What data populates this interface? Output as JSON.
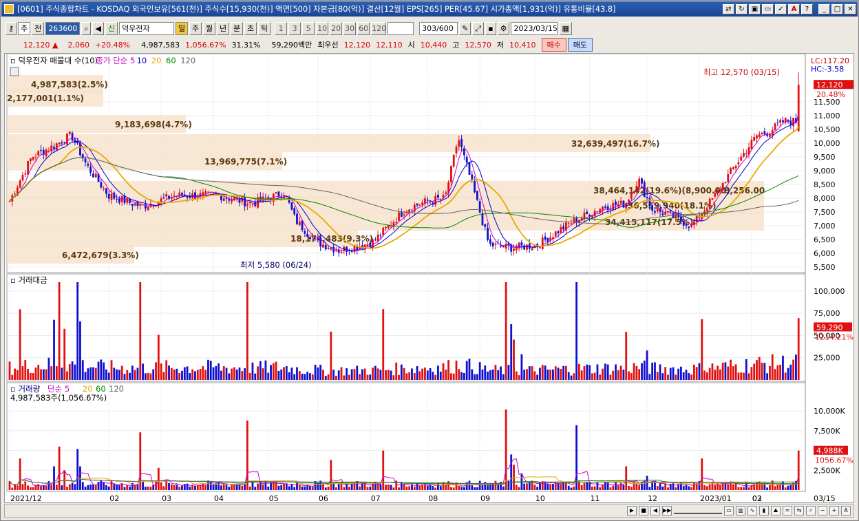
{
  "window": {
    "title": "[0601] 주식종합차트 - KOSDAQ 외국인보유[561(천)] 주식수[15,930(천)] 액면[500] 자본금[80(억)] 결산[12월] EPS[265] PER[45.67] 시가총액[1,931(억)] 유통비율[43.8]"
  },
  "toolbar": {
    "unit": "주",
    "pre": "전",
    "code": "263600",
    "badge": "신",
    "name": "덕우전자",
    "mode": "일",
    "periods": [
      "주",
      "월",
      "년",
      "분",
      "초",
      "틱"
    ],
    "nums": [
      "1",
      "3",
      "5",
      "10",
      "20",
      "30",
      "60",
      "120"
    ],
    "count": "303",
    "count_max": "/600",
    "date": "2023/03/15"
  },
  "quote": {
    "price": "12,120",
    "arrow": "▲",
    "change": "2,060",
    "change_pct": "+20.48%",
    "volume": "4,987,583",
    "volume_pct": "1,056.67%",
    "turnover": "31.31%",
    "amount": "59,290백만",
    "best": "최우선",
    "ask": "12,120",
    "bid": "12,110",
    "open_label": "시",
    "open": "10,440",
    "high_label": "고",
    "high": "12,570",
    "low_label": "저",
    "low": "10,410",
    "buy": "매수",
    "sell": "매도"
  },
  "chart_data": {
    "type": "candlestick",
    "price_panel": {
      "legend": [
        "덕우전자 매물대 수(10)",
        "종가 단순 5",
        "10",
        "20",
        "60",
        "120"
      ],
      "lc": "LC:117.20",
      "hc": "HC:-3.58",
      "last_price": "12,120",
      "last_pct": "20.48%",
      "high_marker": "최고 12,570 (03/15)",
      "low_marker": "최저 5,580 (06/24)",
      "yticks": [
        "11,500",
        "11,000",
        "10,500",
        "10,000",
        "9,500",
        "9,000",
        "8,500",
        "8,000",
        "7,500",
        "7,000",
        "6,500",
        "6,000",
        "5,500"
      ],
      "ylim": [
        5400,
        12800
      ],
      "volume_profile": [
        {
          "label": "4,987,583(2.5%)",
          "price": 12150
        },
        {
          "label": "2,177,001(1.1%)",
          "price": 11650
        },
        {
          "label": "9,183,698(4.7%)",
          "price": 10700
        },
        {
          "label": "32,639,497(16.7%)",
          "price": 10000
        },
        {
          "label": "13,969,775(7.1%)",
          "price": 9350
        },
        {
          "label": "38,464,142(19.6%)(8,900.00)",
          "price": 8300
        },
        {
          "label": "8,256.00",
          "price": 8300
        },
        {
          "label": "36,559,940(18.1%)",
          "price": 7750
        },
        {
          "label": "34,415,117(17.5%)",
          "price": 7150
        },
        {
          "label": "18,174,483(9.3%)",
          "price": 6550
        },
        {
          "label": "6,472,679(3.3%)",
          "price": 5950
        }
      ]
    },
    "amount_panel": {
      "title": "거래대금",
      "yticks": [
        "100,000",
        "75,000",
        "50,000",
        "25,000"
      ],
      "last": "59,290",
      "last_pct": "1214.21%"
    },
    "volume_panel": {
      "legend": [
        "거래량",
        "단순 5",
        "20",
        "60",
        "120"
      ],
      "sub": "4,987,583주(1,056.67%)",
      "yticks": [
        "10,000K",
        "7,500K",
        "5,000K",
        "2,500K"
      ],
      "last": "4,988K",
      "last_pct": "1056.67%"
    },
    "x_labels": [
      "2021/12",
      "02",
      "03",
      "04",
      "05",
      "06",
      "07",
      "08",
      "09",
      "10",
      "11",
      "12",
      "2023/01",
      "02",
      "03",
      "03/15"
    ],
    "colors": {
      "up": "#e01010",
      "down": "#1010d0",
      "ma5": "#cc00cc",
      "ma10": "#0000cc",
      "ma20": "#e8a800",
      "ma60": "#008800",
      "ma120": "#666666"
    }
  }
}
